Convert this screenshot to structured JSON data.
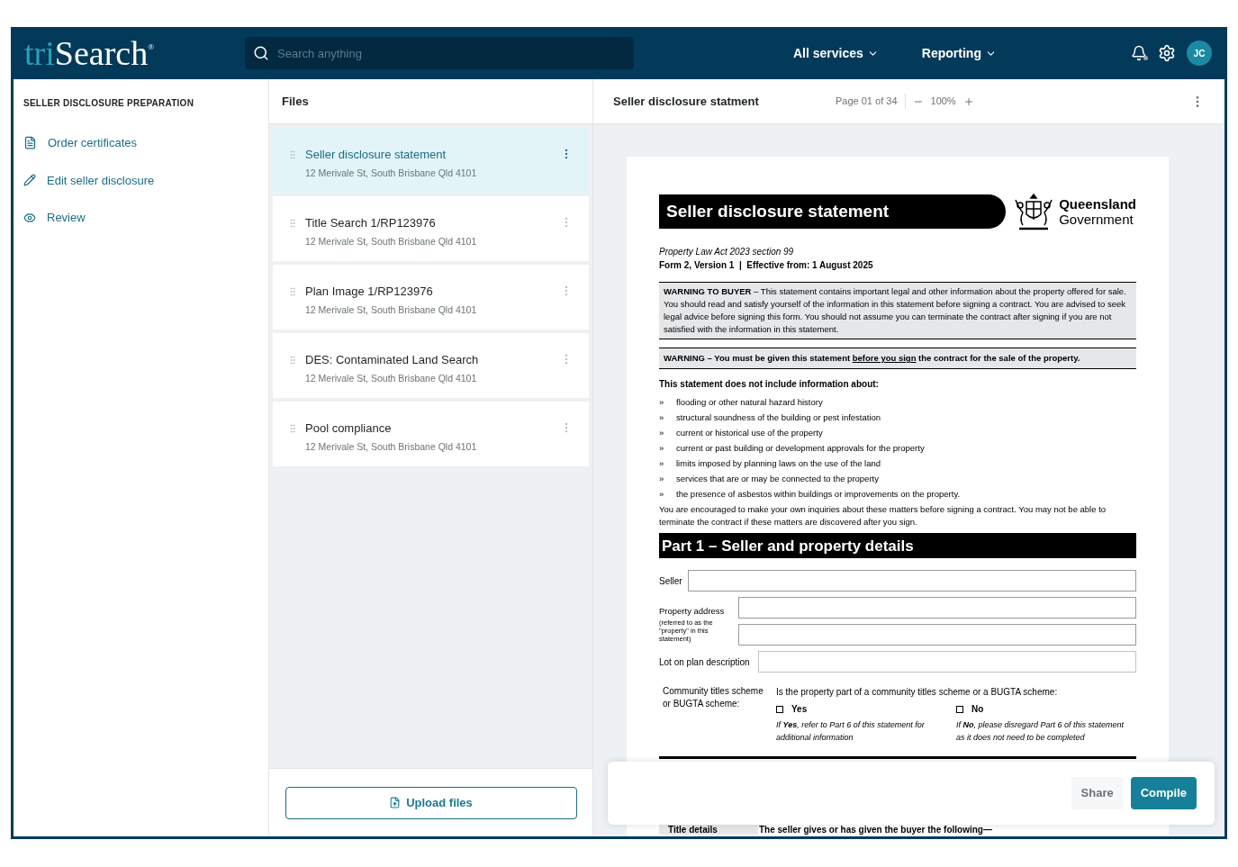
{
  "header": {
    "logo": {
      "prefix": "tri",
      "name": "Search",
      "mark": "®"
    },
    "search": {
      "placeholder": "Search anything"
    },
    "menus": [
      {
        "label": "All services"
      },
      {
        "label": "Reporting"
      }
    ],
    "notifications": {
      "unread": true
    },
    "avatar": {
      "initials": "JC"
    }
  },
  "sidebar": {
    "title": "SELLER DISCLOSURE PREPARATION",
    "items": [
      {
        "label": "Order certificates"
      },
      {
        "label": "Edit seller disclosure"
      },
      {
        "label": "Review"
      }
    ]
  },
  "files": {
    "title": "Files",
    "items": [
      {
        "name": "Seller disclosure statement",
        "address": "12 Merivale St, South Brisbane Qld 4101",
        "selected": true
      },
      {
        "name": "Title Search 1/RP123976",
        "address": "12 Merivale St, South Brisbane Qld 4101",
        "selected": false
      },
      {
        "name": "Plan Image 1/RP123976",
        "address": "12 Merivale St, South Brisbane Qld 4101",
        "selected": false
      },
      {
        "name": "DES: Contaminated Land Search",
        "address": "12 Merivale St, South Brisbane Qld 4101",
        "selected": false
      },
      {
        "name": "Pool compliance",
        "address": "12 Merivale St, South Brisbane Qld 4101",
        "selected": false
      }
    ],
    "upload_button": "Upload files"
  },
  "viewer": {
    "title": "Seller disclosure statment",
    "page_indicator": "Page 01 of 34",
    "zoom": "100%",
    "document": {
      "title": "Seller disclosure statement",
      "issuer": [
        "Queensland",
        "Government"
      ],
      "act": "Property Law Act 2023 section 99",
      "form": "Form 2, Version 1  |  Effective from: 1 August 2025",
      "warning_buyer": "**WARNING TO BUYER** – This statement contains important legal and other information about the property offered for sale. You should read and satisfy yourself of the information in this statement before signing a contract. You are advised to seek legal advice before signing this form. You should not assume you can terminate the contract after signing if you are not satisfied with the information in this statement.",
      "warning_sign": {
        "before": "WARNING – You must be given this statement ",
        "underlined": "before you sign",
        "after": " the contract for the sale of the property."
      },
      "exclusions_heading": "This statement does not include information about:",
      "exclusions": [
        {
          "bullet": "»",
          "text": "flooding or other natural hazard history"
        },
        {
          "bullet": "»",
          "text": "structural soundness of the building or pest infestation"
        },
        {
          "bullet": "»",
          "text": "current or historical use of the property"
        },
        {
          "bullet": "»",
          "text": "current or past building or development approvals for the property"
        },
        {
          "bullet": "»",
          "text": "limits imposed by planning laws on the use of the land"
        },
        {
          "bullet": "»",
          "text": "services that are or may be connected to the property"
        },
        {
          "bullet": "»",
          "text": "the presence of asbestos within buildings or improvements on the property."
        }
      ],
      "advice": "You are encouraged to make your own inquiries about these matters before signing a contract. You may not be able to terminate the contract if these matters are discovered after you sign.",
      "part_heading": "Part 1 – Seller and property details",
      "fields": {
        "seller": "Seller",
        "property_address": "Property address",
        "property_note": "(referred to as the \"property\" in this statement)",
        "lot": "Lot on plan description"
      },
      "scheme": {
        "label": "Community titles scheme or BUGTA scheme:",
        "question": "Is the property part of a community titles scheme or a BUGTA scheme:",
        "options": [
          {
            "label": "Yes",
            "checked": false,
            "note": "If **Yes**, refer to Part 6 of this statement for additional information"
          },
          {
            "label": "No",
            "checked": false,
            "note": "If **No**, please disregard Part 6 of this statement as it does not need to be completed"
          }
        ]
      },
      "next_row": {
        "label": "Title details",
        "text": "The seller gives or has given the buyer the following—"
      }
    },
    "actions": [
      {
        "label": "Share",
        "kind": "secondary"
      },
      {
        "label": "Compile",
        "kind": "primary"
      }
    ]
  }
}
